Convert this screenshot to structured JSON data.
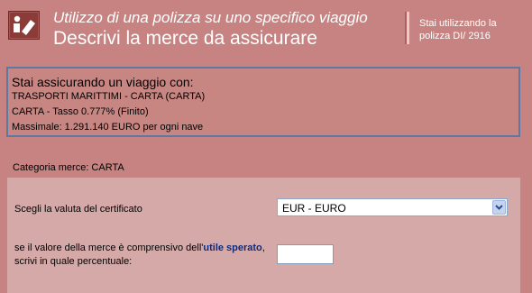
{
  "header": {
    "subtitle": "Utilizzo di una polizza su uno specifico viaggio",
    "title": "Descrivi la merce da assicurare",
    "policy_note": "Stai utilizzando la polizza DI/ 2916",
    "icon": "person-document-icon"
  },
  "trip": {
    "heading": "Stai assicurando un viaggio con:",
    "transport": "TRASPORTI MARITTIMI - CARTA (CARTA)",
    "rate": "CARTA - Tasso 0.777% (Finito)",
    "limit": "Massimale:  1.291.140 EURO per ogni nave"
  },
  "category": "Categoria merce: CARTA",
  "form": {
    "currency_label": "Scegli la valuta del certificato",
    "currency_selected": "EUR - EURO",
    "profit_label_before": "se il valore della merce è comprensivo dell'",
    "profit_link": "utile sperato",
    "profit_label_after": ", scrivi in quale percentuale:",
    "profit_value": ""
  },
  "colors": {
    "background": "#c78381",
    "panel": "#d6a9a9",
    "box_border": "#5e78a4",
    "link": "#102a7a"
  }
}
